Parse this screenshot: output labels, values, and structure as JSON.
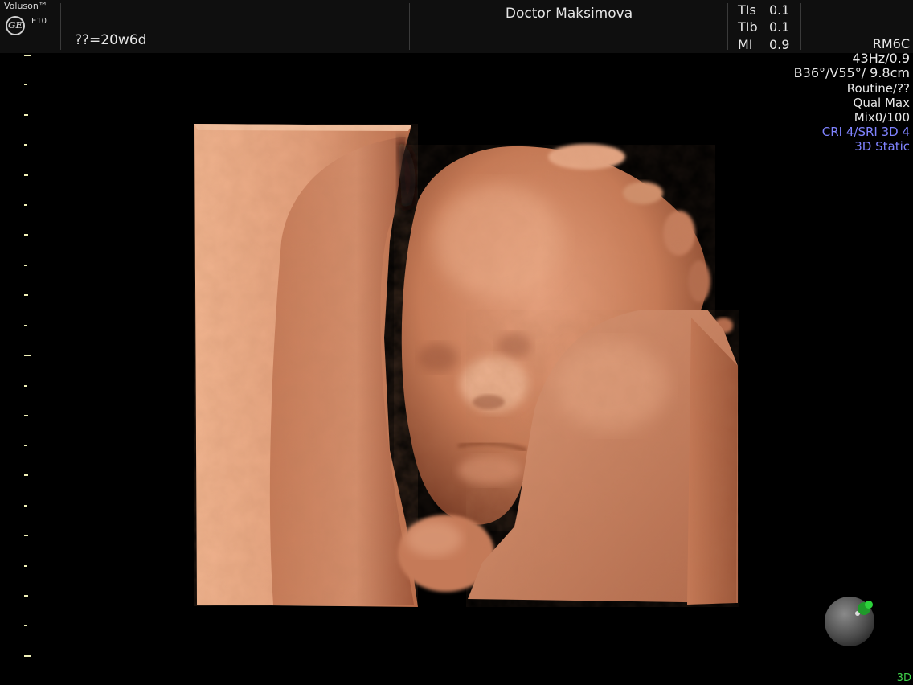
{
  "header": {
    "brand": "Voluson™",
    "logo_text": "GE",
    "model": "E10",
    "gestational_age": "??=20w6d",
    "operator": "Doctor Maksimova",
    "safety": [
      {
        "label": "TIs",
        "value": "0.1"
      },
      {
        "label": "TIb",
        "value": "0.1"
      },
      {
        "label": "MI",
        "value": "0.9"
      }
    ]
  },
  "params": {
    "probe": "RM6C",
    "frequency": "43Hz/0.9",
    "angles": "B36°/V55°/ 9.8cm",
    "preset": "Routine/??",
    "quality": "Qual Max",
    "mix": "Mix0/100",
    "filters": "CRI 4/SRI 3D 4",
    "render_mode": "3D Static"
  },
  "mode_label": "3D",
  "icons": {
    "logo": "ge-logo-icon",
    "orientation": "orientation-ball-icon"
  },
  "colors": {
    "background": "#000000",
    "header": "#0f0f0f",
    "params_text": "#e8e8e8",
    "params_highlight": "#7f83ff",
    "scale_ticks": "#f0f0b8",
    "mode_label": "#3fd24a",
    "tissue": "#c97a58"
  }
}
